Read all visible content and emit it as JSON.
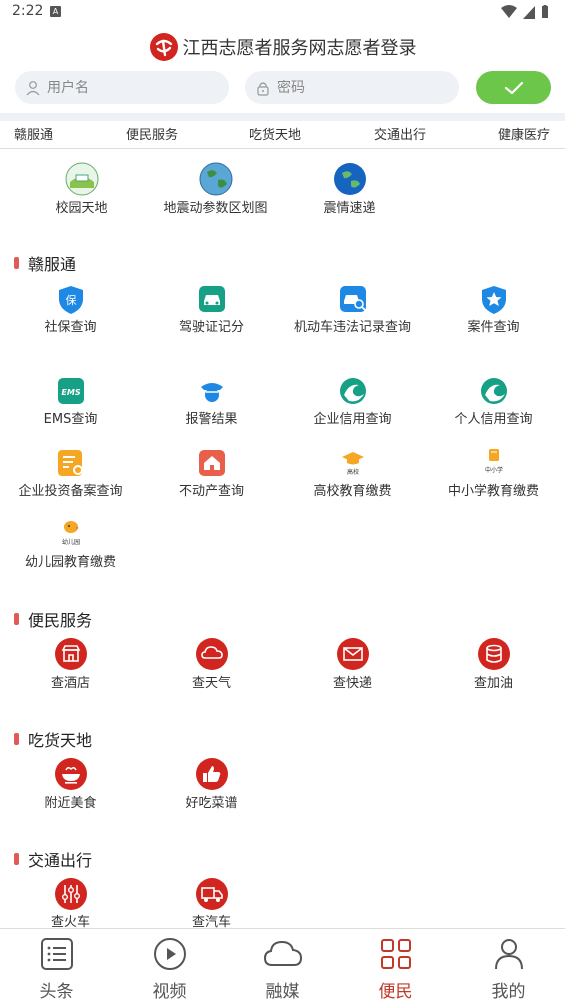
{
  "status_bar": {
    "time": "2:22",
    "notif_letter": "A"
  },
  "header": {
    "title": "江西志愿者服务网志愿者登录",
    "logo_text": "志"
  },
  "login": {
    "username_placeholder": "用户名",
    "password_placeholder": "密码"
  },
  "tabs": [
    "赣服通",
    "便民服务",
    "吃货天地",
    "交通出行",
    "健康医疗"
  ],
  "top_items": [
    {
      "label": "校园天地",
      "icon": "campus-globe-icon"
    },
    {
      "label": "地震动参数区划图",
      "icon": "earth-icon"
    },
    {
      "label": "震情速递",
      "icon": "earth-icon"
    }
  ],
  "sections": [
    {
      "title": "赣服通",
      "items": [
        {
          "label": "社保查询",
          "icon": "shield-icon",
          "glyph": "保"
        },
        {
          "label": "驾驶证记分",
          "icon": "car-icon"
        },
        {
          "label": "机动车违法记录查询",
          "icon": "car-search-icon"
        },
        {
          "label": "案件查询",
          "icon": "star-shield-icon"
        },
        {
          "label": "EMS查询",
          "icon": "ems-icon",
          "glyph": "EMS"
        },
        {
          "label": "报警结果",
          "icon": "police-icon"
        },
        {
          "label": "企业信用查询",
          "icon": "wave-icon"
        },
        {
          "label": "个人信用查询",
          "icon": "wave-icon"
        },
        {
          "label": "企业投资备案查询",
          "icon": "document-icon"
        },
        {
          "label": "不动产查询",
          "icon": "house-icon"
        },
        {
          "label": "高校教育缴费",
          "icon": "graduation-cap-icon",
          "glyph": "高校"
        },
        {
          "label": "中小学教育缴费",
          "icon": "book-icon",
          "glyph": "中小学"
        },
        {
          "label": "幼儿园教育缴费",
          "icon": "chick-icon",
          "glyph": "幼儿园"
        }
      ]
    },
    {
      "title": "便民服务",
      "items": [
        {
          "label": "查酒店",
          "icon": "hotel-icon"
        },
        {
          "label": "查天气",
          "icon": "cloud-icon"
        },
        {
          "label": "查快递",
          "icon": "envelope-icon"
        },
        {
          "label": "查加油",
          "icon": "fuel-icon"
        }
      ]
    },
    {
      "title": "吃货天地",
      "items": [
        {
          "label": "附近美食",
          "icon": "food-bowl-icon"
        },
        {
          "label": "好吃菜谱",
          "icon": "thumbs-up-icon"
        }
      ]
    },
    {
      "title": "交通出行",
      "items": [
        {
          "label": "查火车",
          "icon": "train-icon"
        },
        {
          "label": "查汽车",
          "icon": "truck-icon"
        }
      ]
    }
  ],
  "nav": [
    {
      "label": "头条",
      "icon": "list-icon"
    },
    {
      "label": "视频",
      "icon": "play-icon"
    },
    {
      "label": "融媒",
      "icon": "cloud-outline-icon"
    },
    {
      "label": "便民",
      "icon": "grid-icon",
      "active": true
    },
    {
      "label": "我的",
      "icon": "person-icon"
    }
  ],
  "colors": {
    "accent_red": "#d1261f",
    "green_button": "#6cc64a",
    "blue_icon": "#1e88e5",
    "teal_icon": "#16a085",
    "orange_icon": "#f5a623",
    "section_bar": "#e05a57"
  }
}
